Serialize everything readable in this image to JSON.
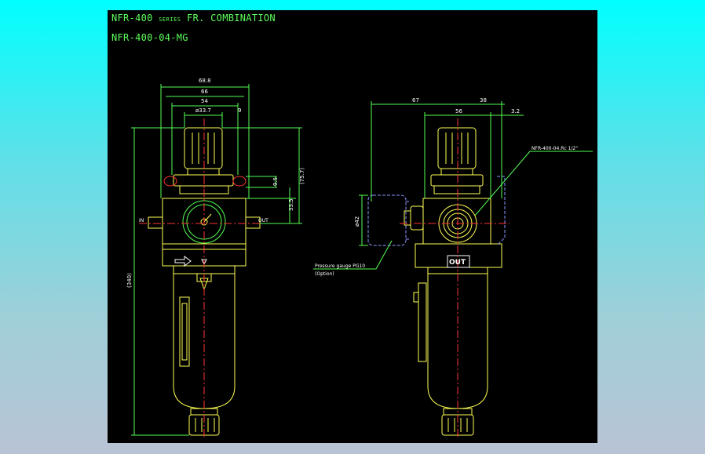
{
  "drawing": {
    "title_main": "NFR-400",
    "title_series": "SERIES",
    "title_rest": "FR. COMBINATION",
    "model": "NFR-400-04-MG",
    "colors": {
      "background": "#000000",
      "outline": "#ffff55",
      "dimension": "#55ff55",
      "centerline": "#ff3333",
      "hidden": "#8899ff",
      "text": "#ffffff"
    },
    "front_view": {
      "dims": {
        "w688": "68.8",
        "w66": "66",
        "w54": "54",
        "dia": "ø33.7",
        "h9": "9",
        "h95": "9.5",
        "h757": "(75.7)",
        "h335": "33.5",
        "h340": "(340)"
      },
      "in_label": "IN",
      "out_label": "OUT"
    },
    "side_view": {
      "dims": {
        "w67": "67",
        "w38": "38",
        "w56": "56",
        "w32": "3.2",
        "d42": "ø42"
      },
      "port_label": "NFR-400-04.Rc 1/2\"",
      "gauge_label": "Pressure gauge PG10",
      "gauge_option": "(Option)",
      "out_badge": "OUT"
    }
  }
}
